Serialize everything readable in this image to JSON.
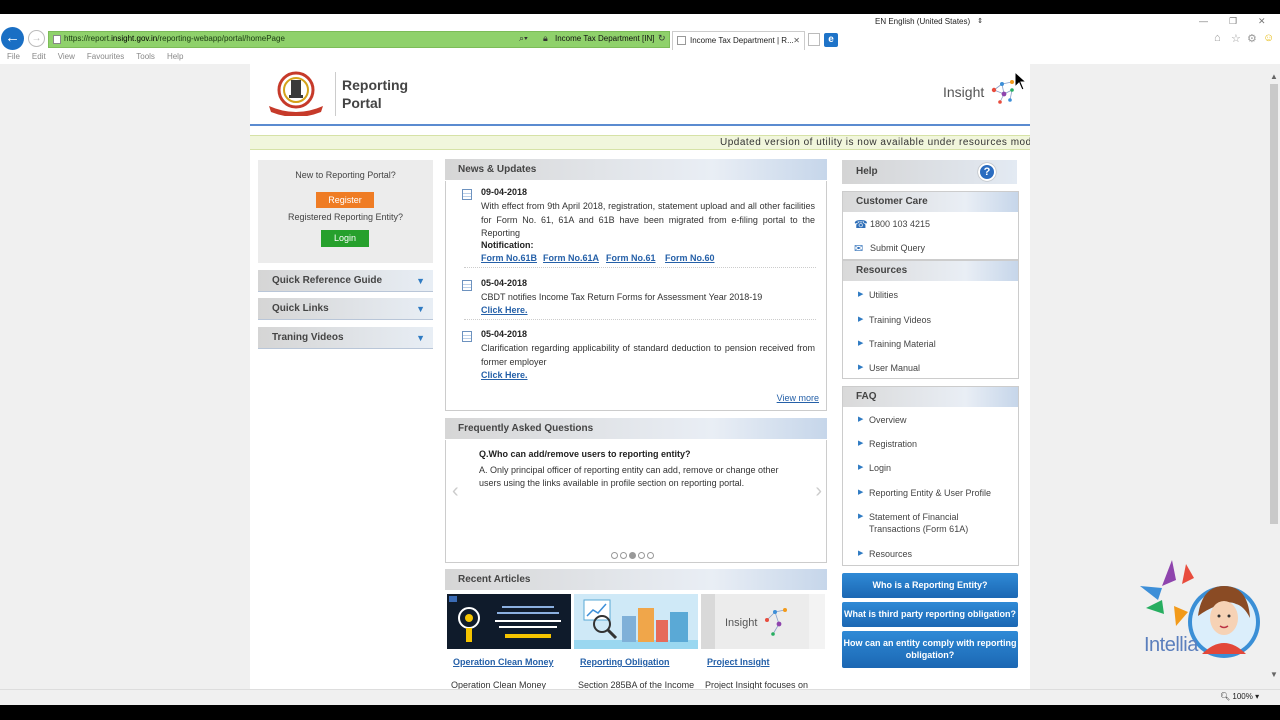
{
  "browser": {
    "language": "EN English (United States)",
    "url_prefix": "https://report.",
    "url_domain": "insight.gov.in",
    "url_path": "/reporting-webapp/portal/homePage",
    "cert_label": "Income Tax Department [IN]",
    "tab_title": "Income Tax Department | R...",
    "menu": [
      "File",
      "Edit",
      "View",
      "Favourites",
      "Tools",
      "Help"
    ],
    "zoom": "100%"
  },
  "site": {
    "portal_title": "Reporting Portal",
    "insight_label": "Insight",
    "ticker": "Updated version of utility is now available under resources modul"
  },
  "login": {
    "new_prompt": "New to Reporting Portal?",
    "register_label": "Register",
    "registered_prompt": "Registered Reporting Entity?",
    "login_label": "Login"
  },
  "left_accordion": [
    "Quick Reference Guide",
    "Quick Links",
    "Traning Videos"
  ],
  "news": {
    "header": "News & Updates",
    "items": [
      {
        "date": "09-04-2018",
        "text": "With effect from 9th April 2018, registration, statement upload and all other facilities for Form No. 61, 61A and 61B have been migrated from e-filing portal to the Reporting",
        "notification_label": "Notification:",
        "links": [
          "Form No.61B",
          "Form No.61A",
          "Form No.61",
          "Form No.60"
        ]
      },
      {
        "date": "05-04-2018",
        "text": "CBDT notifies Income Tax Return Forms for Assessment Year 2018-19",
        "link": "Click Here."
      },
      {
        "date": "05-04-2018",
        "text": "Clarification regarding applicability of standard deduction to pension received from former employer",
        "link": "Click Here."
      }
    ],
    "view_more": "View more"
  },
  "faq": {
    "header": "Frequently Asked Questions",
    "question": "Q.Who can add/remove users to reporting entity?",
    "answer": "A. Only principal officer of reporting entity can add, remove or change other users using the links available in profile section on reporting portal."
  },
  "articles": {
    "header": "Recent Articles",
    "items": [
      {
        "title": "Operation Clean Money",
        "desc": "Operation Clean Money",
        "img_text": "OUR NATION RUNS ON THE STRENGTH OF ITS HONEST TAXPAYERS! COME, LET'S CELEBRATE THIS HONESTY WITH OPERATION CLEAN MONEY"
      },
      {
        "title": "Reporting Obligation",
        "desc": "Section 285BA of the Income"
      },
      {
        "title": "Project Insight",
        "desc": "Project Insight focuses on",
        "img_text": "Insight"
      }
    ]
  },
  "right": {
    "help_label": "Help",
    "customer_care": {
      "header": "Customer Care",
      "phone": "1800 103 4215",
      "submit": "Submit Query"
    },
    "resources": {
      "header": "Resources",
      "items": [
        "Utilities",
        "Training Videos",
        "Training Material",
        "User Manual"
      ]
    },
    "faq": {
      "header": "FAQ",
      "items": [
        "Overview",
        "Registration",
        "Login",
        "Reporting Entity & User Profile",
        "Statement of Financial Transactions (Form 61A)",
        "Resources"
      ]
    },
    "buttons": [
      "Who is a Reporting Entity?",
      "What is third party reporting obligation?",
      "How can an entity comply with reporting obligation?"
    ]
  },
  "overlay": {
    "brand": "Intellia"
  },
  "colors": {
    "register": "#ef7c24",
    "login": "#26a02c",
    "link": "#2560a8",
    "accent": "#2a6cc0"
  }
}
